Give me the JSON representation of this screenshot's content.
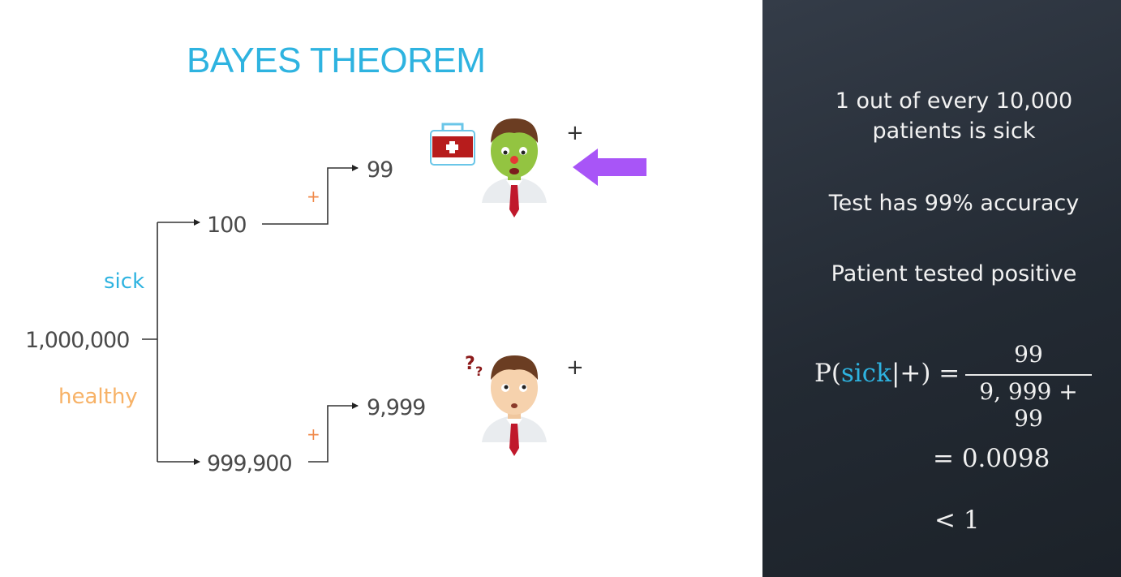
{
  "title": "BAYES THEOREM",
  "tree": {
    "root": "1,000,000",
    "branch_sick": "sick",
    "branch_healthy": "healthy",
    "sick_count": "100",
    "healthy_count": "999,900",
    "sick_positive": "99",
    "healthy_positive": "9,999",
    "plus_marker": "+"
  },
  "facts": {
    "line1": "1 out of every 10,000",
    "line2": "patients is sick",
    "accuracy": "Test has 99% accuracy",
    "positive": "Patient tested positive"
  },
  "formula": {
    "lhs_p": "P(",
    "lhs_sick": "sick",
    "lhs_rest": "|+) =",
    "numerator": "99",
    "denominator": "9, 999 + 99",
    "result": "= 0.0098",
    "bound": "< 1"
  },
  "colors": {
    "title": "#2eb3e0",
    "sick": "#2eb3e0",
    "healthy": "#f7b267",
    "plus": "#f08a4b",
    "arrow": "#a855f7",
    "panel": "#2a313b"
  },
  "icons": [
    "medical-kit-icon",
    "sick-patient-icon",
    "worried-patient-icon",
    "question-marks-icon",
    "pointer-arrow-icon"
  ]
}
